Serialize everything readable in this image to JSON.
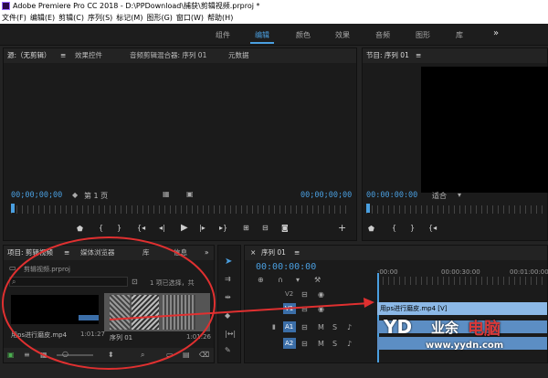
{
  "title": "Adobe Premiere Pro CC 2018 - D:\\PPDownload\\捕获\\剪辑视频.prproj *",
  "menu": [
    "文件(F)",
    "编辑(E)",
    "剪辑(C)",
    "序列(S)",
    "标记(M)",
    "图形(G)",
    "窗口(W)",
    "帮助(H)"
  ],
  "workspaces": [
    "组件",
    "编辑",
    "颜色",
    "效果",
    "音频",
    "图形",
    "库"
  ],
  "workspace_more": "»",
  "source_panel": {
    "tabs": [
      "源:（无剪辑）",
      "效果控件",
      "音频剪辑混合器: 序列 01",
      "元数据"
    ],
    "tc_left": "00;00;00;00",
    "page_select": "第 1 页",
    "tc_right": "00;00;00;00"
  },
  "program_panel": {
    "tab": "节目: 序列 01",
    "tc_left": "00:00:00:00",
    "fit": "适合",
    "tc_right": "00:00:00:00"
  },
  "project_panel": {
    "tabs": [
      "项目: 剪辑视频",
      "媒体浏览器",
      "库",
      "信息"
    ],
    "project_file": "剪辑视频.prproj",
    "selection_info": "1 项已选择，共",
    "clip1": {
      "name": "用ps进行磨皮.mp4",
      "duration": "1:01:27"
    },
    "clip2": {
      "name": "序列 01",
      "duration": "1:01:26"
    }
  },
  "timeline": {
    "tab": "序列 01",
    "tc": "00:00:00:00",
    "ruler_marks": [
      ":00:00",
      "00:00:30:00",
      "00:01:00:00"
    ],
    "tracks": [
      {
        "id": "V2",
        "type": "video"
      },
      {
        "id": "V1",
        "type": "video"
      },
      {
        "id": "A1",
        "type": "audio"
      },
      {
        "id": "A2",
        "type": "audio"
      }
    ],
    "clip_label": "用ps进行磨皮.mp4 [V]"
  },
  "watermark": {
    "brand": "电脑",
    "prefix": "业余",
    "url": "www.yydn.com"
  },
  "colors": {
    "accent": "#4a9fe0",
    "annotation": "#e03030",
    "clip": "#8bb8e6"
  }
}
